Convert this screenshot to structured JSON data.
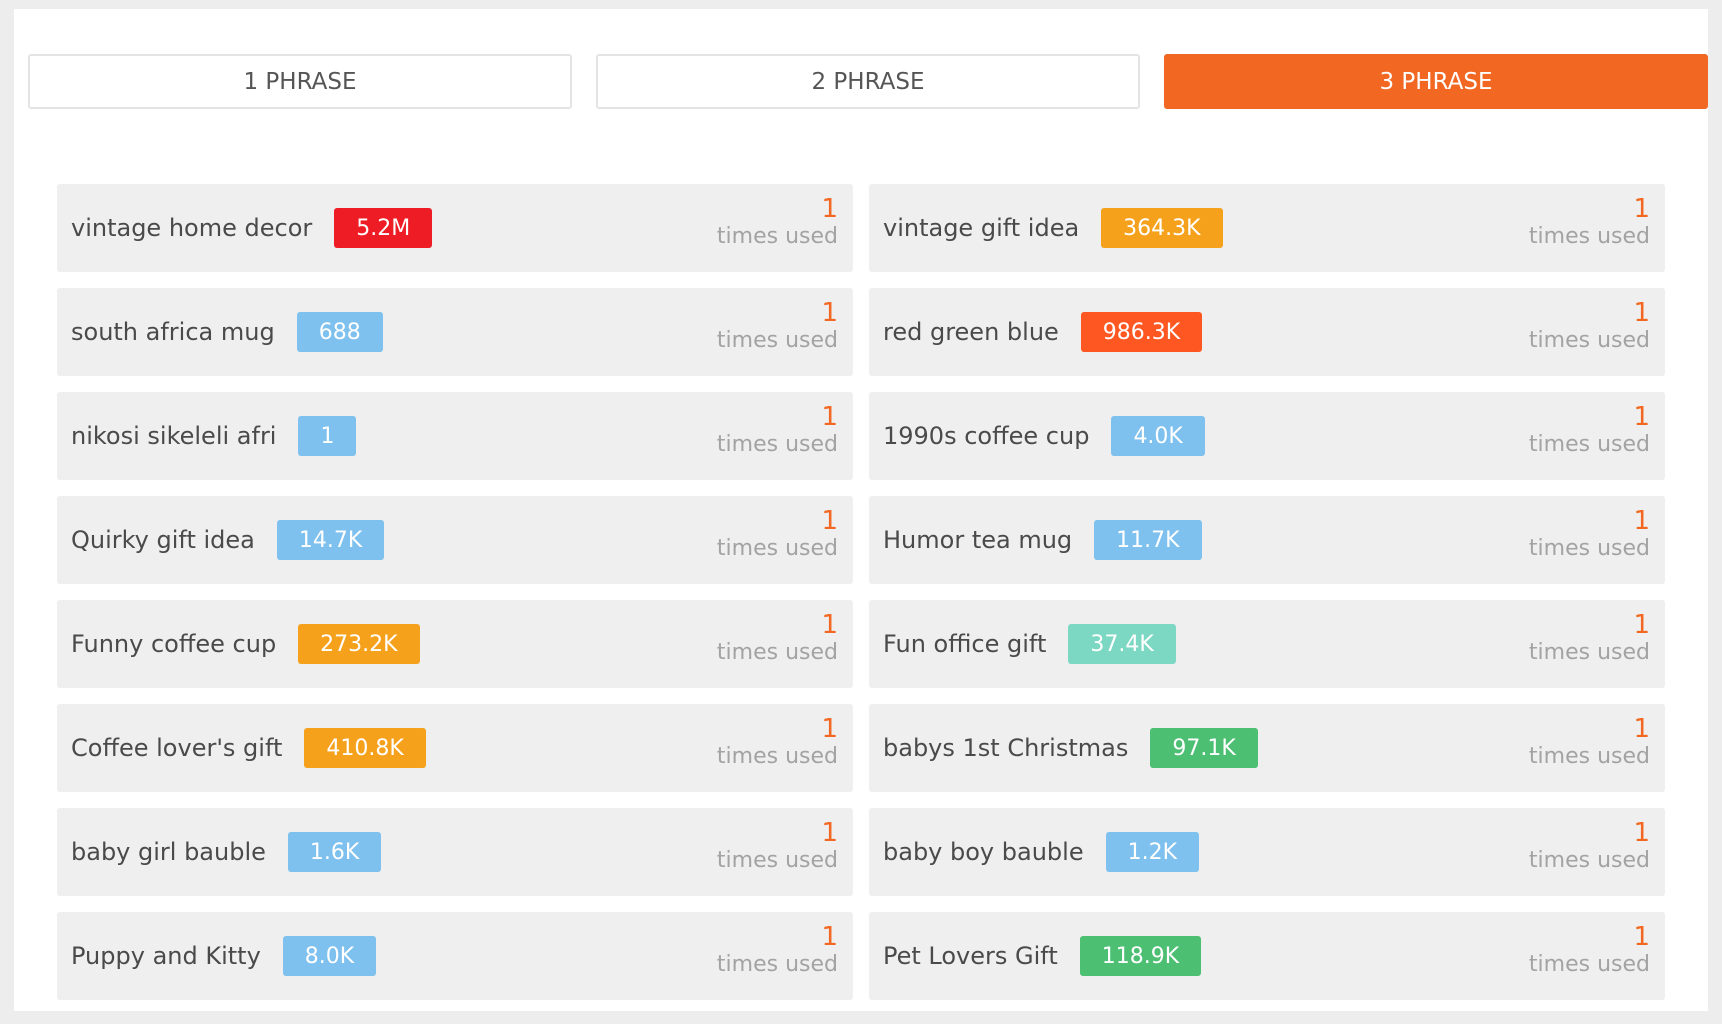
{
  "tabs": [
    {
      "label": "1 PHRASE",
      "active": false
    },
    {
      "label": "2 PHRASE",
      "active": false
    },
    {
      "label": "3 PHRASE",
      "active": true
    }
  ],
  "colors": {
    "accent": "#f26722",
    "badge_red": "#ee1c25",
    "badge_orange_red": "#ff5722",
    "badge_orange": "#f5a11c",
    "badge_blue": "#7ec0ee",
    "badge_teal": "#7dd8c3",
    "badge_green": "#4cbf73"
  },
  "items": [
    {
      "phrase": "vintage home decor",
      "volume": "5.2M",
      "color": "#ee1c25",
      "count": "1",
      "count_label": "times used"
    },
    {
      "phrase": "vintage gift idea",
      "volume": "364.3K",
      "color": "#f5a11c",
      "count": "1",
      "count_label": "times used"
    },
    {
      "phrase": "south africa mug",
      "volume": "688",
      "color": "#7ec0ee",
      "count": "1",
      "count_label": "times used"
    },
    {
      "phrase": "red green blue",
      "volume": "986.3K",
      "color": "#ff5722",
      "count": "1",
      "count_label": "times used"
    },
    {
      "phrase": "nikosi sikeleli afri",
      "volume": "1",
      "color": "#7ec0ee",
      "count": "1",
      "count_label": "times used"
    },
    {
      "phrase": "1990s coffee cup",
      "volume": "4.0K",
      "color": "#7ec0ee",
      "count": "1",
      "count_label": "times used"
    },
    {
      "phrase": "Quirky gift idea",
      "volume": "14.7K",
      "color": "#7ec0ee",
      "count": "1",
      "count_label": "times used"
    },
    {
      "phrase": "Humor tea mug",
      "volume": "11.7K",
      "color": "#7ec0ee",
      "count": "1",
      "count_label": "times used"
    },
    {
      "phrase": "Funny coffee cup",
      "volume": "273.2K",
      "color": "#f5a11c",
      "count": "1",
      "count_label": "times used"
    },
    {
      "phrase": "Fun office gift",
      "volume": "37.4K",
      "color": "#7dd8c3",
      "count": "1",
      "count_label": "times used"
    },
    {
      "phrase": "Coffee lover's gift",
      "volume": "410.8K",
      "color": "#f5a11c",
      "count": "1",
      "count_label": "times used"
    },
    {
      "phrase": "babys 1st Christmas",
      "volume": "97.1K",
      "color": "#4cbf73",
      "count": "1",
      "count_label": "times used"
    },
    {
      "phrase": "baby girl bauble",
      "volume": "1.6K",
      "color": "#7ec0ee",
      "count": "1",
      "count_label": "times used"
    },
    {
      "phrase": "baby boy bauble",
      "volume": "1.2K",
      "color": "#7ec0ee",
      "count": "1",
      "count_label": "times used"
    },
    {
      "phrase": "Puppy and Kitty",
      "volume": "8.0K",
      "color": "#7ec0ee",
      "count": "1",
      "count_label": "times used"
    },
    {
      "phrase": "Pet Lovers Gift",
      "volume": "118.9K",
      "color": "#4cbf73",
      "count": "1",
      "count_label": "times used"
    }
  ]
}
